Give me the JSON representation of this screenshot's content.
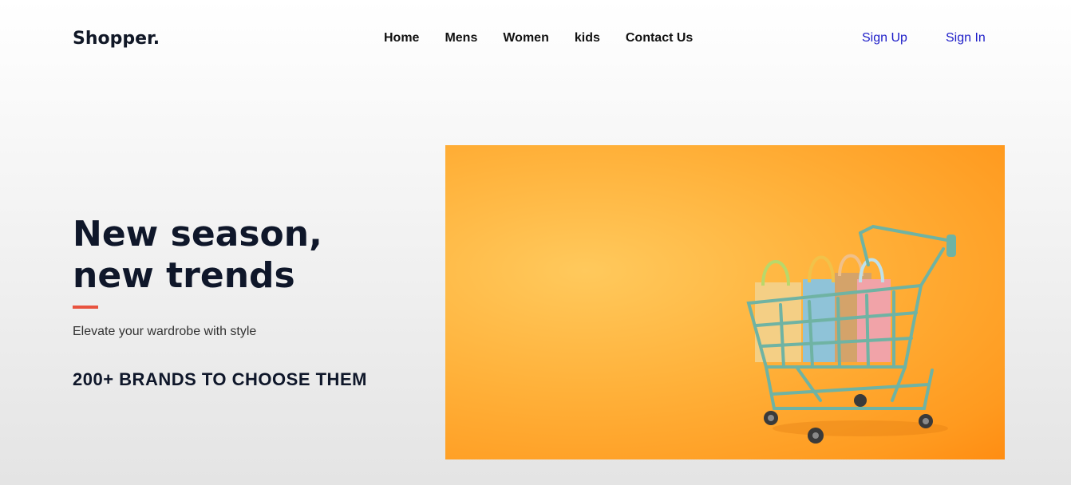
{
  "header": {
    "logo": "Shopper.",
    "nav": [
      "Home",
      "Mens",
      "Women",
      "kids",
      "Contact Us"
    ],
    "sign_up": "Sign Up",
    "sign_in": "Sign In"
  },
  "hero": {
    "headline_line1": "New season,",
    "headline_line2": "new trends",
    "tagline": "Elevate your wardrobe with style",
    "brands": "200+ BRANDS TO CHOOSE THEM",
    "accent_color": "#e8533f",
    "image_bg_color": "#ffa726",
    "image_icon": "shopping-cart-with-bags"
  }
}
